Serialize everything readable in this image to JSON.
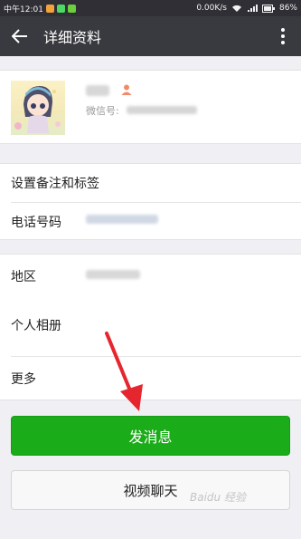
{
  "status_bar": {
    "carrier_time": "中午12:01",
    "speed": "0.00K/s",
    "battery": "86%"
  },
  "toolbar": {
    "title": "详细资料"
  },
  "profile": {
    "wechat_id_label": "微信号:"
  },
  "rows": {
    "remark_tags": "设置备注和标签",
    "phone": "电话号码",
    "region": "地区",
    "album": "个人相册",
    "more": "更多"
  },
  "actions": {
    "send_message": "发消息",
    "video_chat": "视频聊天"
  },
  "watermark": "Baidu 经验",
  "colors": {
    "toolbar_bg": "#393a3f",
    "primary_green": "#1aad19",
    "arrow_red": "#e6262e"
  }
}
